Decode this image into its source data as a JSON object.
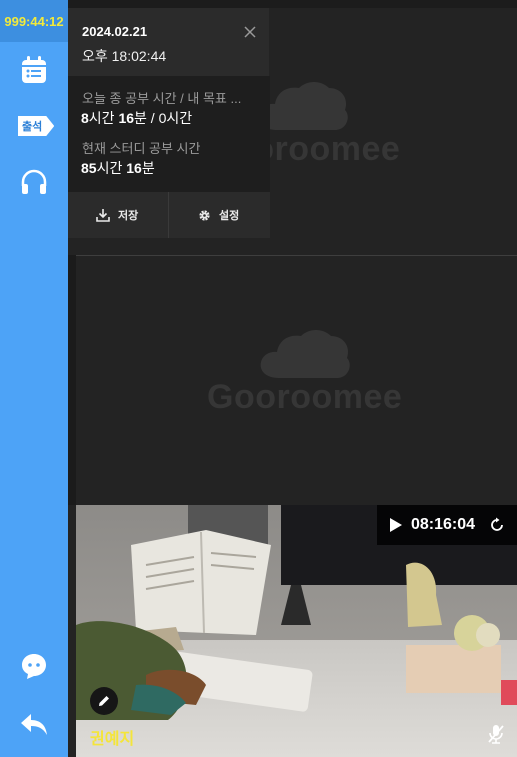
{
  "sidebar": {
    "timer": "999:44:12",
    "attendance_label": "출석",
    "icons": [
      "calendar-icon",
      "headset-icon",
      "chat-icon",
      "exit-icon"
    ]
  },
  "panel": {
    "date": "2024.02.21",
    "time": "오후 18:02:44",
    "today_label": "오늘 종 공부 시간 / 내 목표 ...",
    "today_value": {
      "hours": "8",
      "h_unit": "시간 ",
      "minutes": "16",
      "m_unit": "분 / 0시간"
    },
    "study_label": "현재 스터디 공부 시간",
    "study_value": {
      "hours": "85",
      "h_unit": "시간 ",
      "minutes": "16",
      "m_unit": "분"
    },
    "save_label": "저장",
    "settings_label": "설정"
  },
  "tiles": {
    "logo_text": "Gooroomee"
  },
  "video": {
    "timer": "08:16:04",
    "user_name": "권예지"
  },
  "colors": {
    "sidebar": "#4da3f7",
    "timer_text": "#f2ea3b",
    "name_text": "#f4e53a",
    "background": "#232323"
  }
}
